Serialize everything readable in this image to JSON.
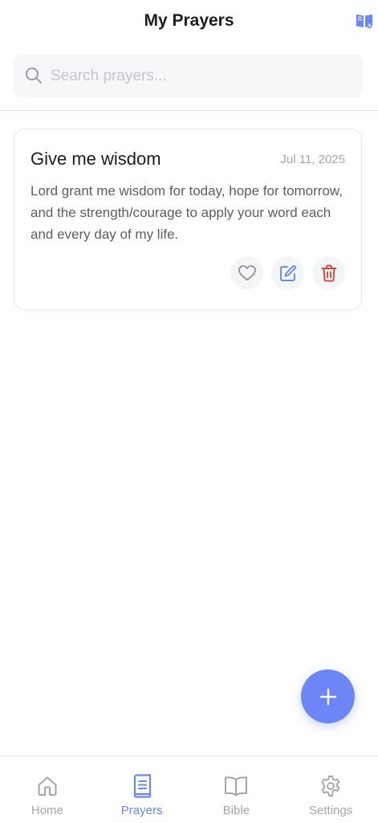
{
  "header": {
    "title": "My Prayers",
    "book_icon": "book-icon"
  },
  "search": {
    "placeholder": "Search prayers...",
    "value": "",
    "icon": "search-icon"
  },
  "prayers": [
    {
      "title": "Give me wisdom",
      "date": "Jul 11, 2025",
      "body": "Lord grant me wisdom for today, hope for tomorrow, and the strength/courage to apply your word each and every day of my life.",
      "actions": [
        "heart-icon",
        "edit-icon",
        "trash-icon"
      ]
    }
  ],
  "fab": {
    "icon": "plus-icon"
  },
  "tabs": [
    {
      "label": "Home",
      "icon": "home-icon",
      "active": false
    },
    {
      "label": "Prayers",
      "icon": "prayers-icon",
      "active": true
    },
    {
      "label": "Bible",
      "icon": "bible-icon",
      "active": false
    },
    {
      "label": "Settings",
      "icon": "settings-icon",
      "active": false
    }
  ],
  "colors": {
    "accent": "#6b86f7",
    "danger": "#d9453c",
    "muted": "#a3a6ad",
    "text": "#1c1d21"
  }
}
